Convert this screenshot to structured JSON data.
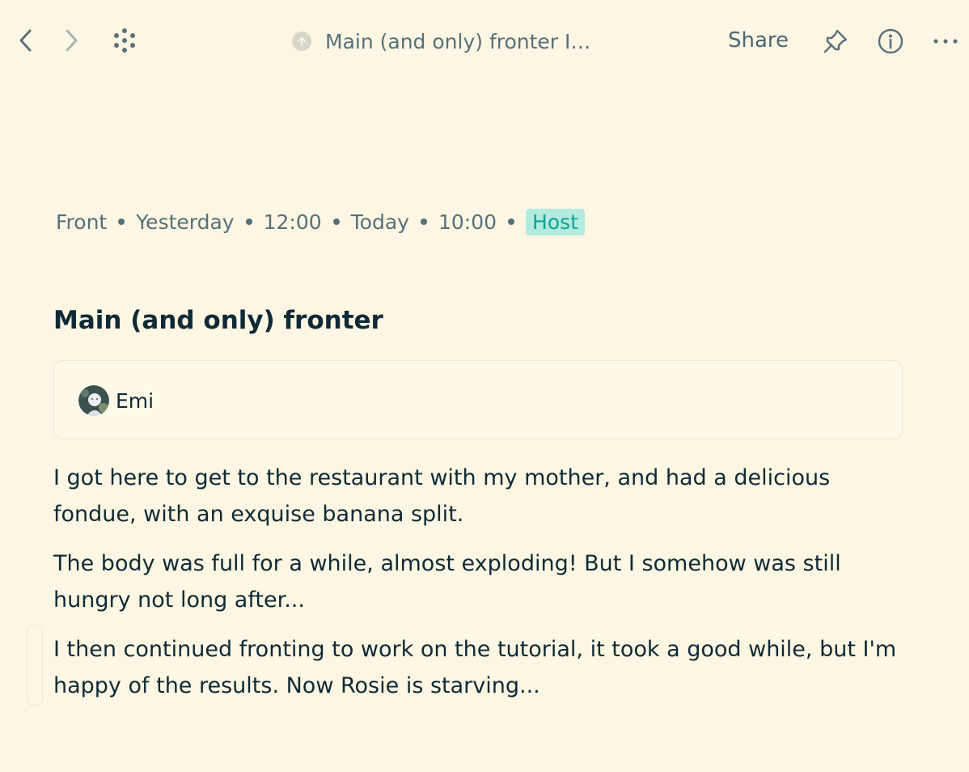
{
  "toolbar": {
    "back_icon": "chevron-left-icon",
    "forward_icon": "chevron-right-icon",
    "grid_icon": "dots-grid-icon",
    "sync_icon": "sync-status-icon",
    "doc_title": "Main (and only) fronter I…",
    "share_label": "Share",
    "pin_icon": "pin-icon",
    "info_icon": "info-icon",
    "more_icon": "more-dots-icon"
  },
  "meta": {
    "type": "Front",
    "start_day": "Yesterday",
    "start_time": "12:00",
    "end_day": "Today",
    "end_time": "10:00",
    "tag": "Host"
  },
  "note": {
    "heading": "Main (and only) fronter",
    "members": [
      {
        "name": "Emi"
      }
    ],
    "paragraphs": [
      "I got here to get to the restaurant with my mother, and had a delicious fondue, with an exquise banana split.",
      "The body was full for a while, almost exploding! But I somehow was still hungry not long after...",
      "I then continued fronting to work on the tutorial, it took a good while, but I'm happy of the results. Now Rosie is starving..."
    ]
  },
  "colors": {
    "background": "#fcf6e3",
    "text": "#0f2a36",
    "muted": "#56707a",
    "tag_bg": "#b2ecdf",
    "tag_text": "#15a196"
  }
}
